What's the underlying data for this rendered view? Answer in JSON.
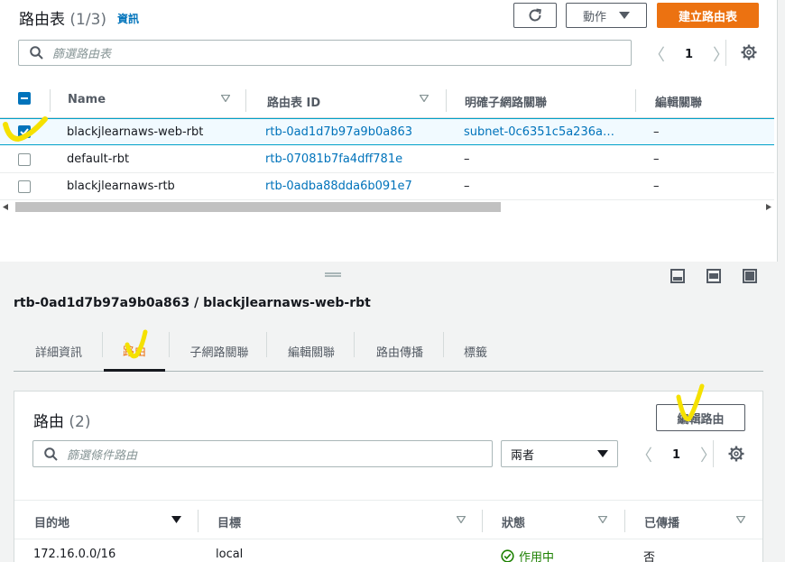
{
  "route_tables": {
    "title": "路由表",
    "count": "(1/3)",
    "info_link": "資訊",
    "actions_label": "動作",
    "create_label": "建立路由表",
    "filter_placeholder": "篩選路由表",
    "page": "1",
    "columns": [
      "Name",
      "路由表 ID",
      "明確子網路關聯",
      "編輯關聯"
    ],
    "rows": [
      {
        "name": "blackjlearnaws-web-rbt",
        "id": "rtb-0ad1d7b97a9b0a863",
        "subnet": "subnet-0c6351c5a236a…",
        "edge": "–",
        "selected": true
      },
      {
        "name": "default-rbt",
        "id": "rtb-07081b7fa4dff781e",
        "subnet": "–",
        "edge": "–",
        "selected": false
      },
      {
        "name": "blackjlearnaws-rtb",
        "id": "rtb-0adba88dda6b091e7",
        "subnet": "–",
        "edge": "–",
        "selected": false
      }
    ]
  },
  "detail": {
    "title": "rtb-0ad1d7b97a9b0a863 / blackjlearnaws-web-rbt",
    "tabs": [
      "詳細資訊",
      "路由",
      "子網路關聯",
      "編輯關聯",
      "路由傳播",
      "標籤"
    ],
    "active_tab": 1
  },
  "routes": {
    "title": "路由",
    "count": "(2)",
    "edit_label": "編輯路由",
    "filter_placeholder": "篩選條件路由",
    "select_value": "兩者",
    "page": "1",
    "columns": [
      "目的地",
      "目標",
      "狀態",
      "已傳播"
    ],
    "rows": [
      {
        "destination": "172.16.0.0/16",
        "target": "local",
        "status": "作用中",
        "propagated": "否"
      }
    ]
  },
  "colors": {
    "accent": "#ec7211",
    "link": "#0073bb",
    "status_ok": "#1d8102",
    "annotation": "#f5e100"
  },
  "icons": [
    "refresh-icon",
    "caret-down-icon",
    "search-icon",
    "chevron-left-icon",
    "chevron-right-icon",
    "gear-icon",
    "sort-icon",
    "status-check-icon",
    "layout-icon"
  ]
}
